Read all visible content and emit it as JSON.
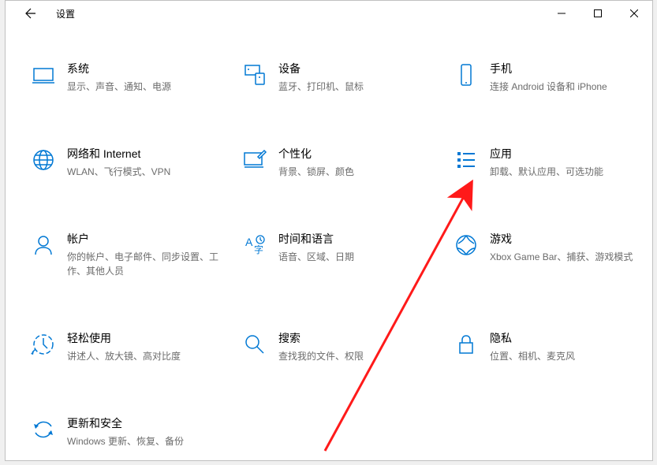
{
  "window": {
    "title": "设置"
  },
  "categories": [
    {
      "id": "system",
      "title": "系统",
      "desc": "显示、声音、通知、电源"
    },
    {
      "id": "devices",
      "title": "设备",
      "desc": "蓝牙、打印机、鼠标"
    },
    {
      "id": "phone",
      "title": "手机",
      "desc": "连接 Android 设备和 iPhone"
    },
    {
      "id": "network",
      "title": "网络和 Internet",
      "desc": "WLAN、飞行模式、VPN"
    },
    {
      "id": "personalization",
      "title": "个性化",
      "desc": "背景、锁屏、颜色"
    },
    {
      "id": "apps",
      "title": "应用",
      "desc": "卸载、默认应用、可选功能"
    },
    {
      "id": "accounts",
      "title": "帐户",
      "desc": "你的帐户、电子邮件、同步设置、工作、其他人员"
    },
    {
      "id": "time",
      "title": "时间和语言",
      "desc": "语音、区域、日期"
    },
    {
      "id": "gaming",
      "title": "游戏",
      "desc": "Xbox Game Bar、捕获、游戏模式"
    },
    {
      "id": "ease",
      "title": "轻松使用",
      "desc": "讲述人、放大镜、高对比度"
    },
    {
      "id": "search",
      "title": "搜索",
      "desc": "查找我的文件、权限"
    },
    {
      "id": "privacy",
      "title": "隐私",
      "desc": "位置、相机、麦克风"
    },
    {
      "id": "update",
      "title": "更新和安全",
      "desc": "Windows 更新、恢复、备份"
    }
  ]
}
